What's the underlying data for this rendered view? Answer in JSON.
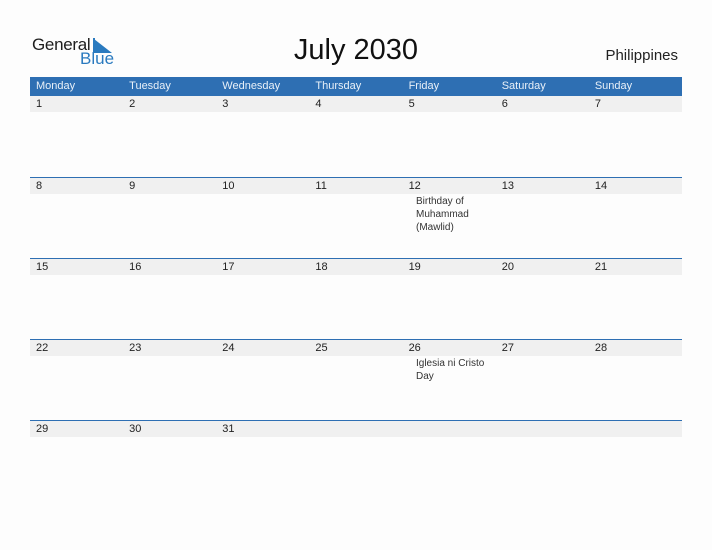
{
  "logo": {
    "general": "General",
    "blue": "Blue"
  },
  "title": "July 2030",
  "country": "Philippines",
  "colors": {
    "header": "#2e6fb3",
    "date_strip": "#f0f0f0",
    "logo_blue": "#2a7abf"
  },
  "weekdays": [
    "Monday",
    "Tuesday",
    "Wednesday",
    "Thursday",
    "Friday",
    "Saturday",
    "Sunday"
  ],
  "weeks": [
    {
      "dates": [
        "1",
        "2",
        "3",
        "4",
        "5",
        "6",
        "7"
      ],
      "events": [
        "",
        "",
        "",
        "",
        "",
        "",
        ""
      ]
    },
    {
      "dates": [
        "8",
        "9",
        "10",
        "11",
        "12",
        "13",
        "14"
      ],
      "events": [
        "",
        "",
        "",
        "",
        "",
        "Birthday of Muhammad (Mawlid)",
        ""
      ]
    },
    {
      "dates": [
        "15",
        "16",
        "17",
        "18",
        "19",
        "20",
        "21"
      ],
      "events": [
        "",
        "",
        "",
        "",
        "",
        "",
        ""
      ]
    },
    {
      "dates": [
        "22",
        "23",
        "24",
        "25",
        "26",
        "27",
        "28"
      ],
      "events": [
        "",
        "",
        "",
        "",
        "",
        "Iglesia ni Cristo Day",
        ""
      ]
    },
    {
      "dates": [
        "29",
        "30",
        "31",
        "",
        "",
        "",
        ""
      ],
      "events": [
        "",
        "",
        "",
        "",
        "",
        "",
        ""
      ]
    }
  ]
}
